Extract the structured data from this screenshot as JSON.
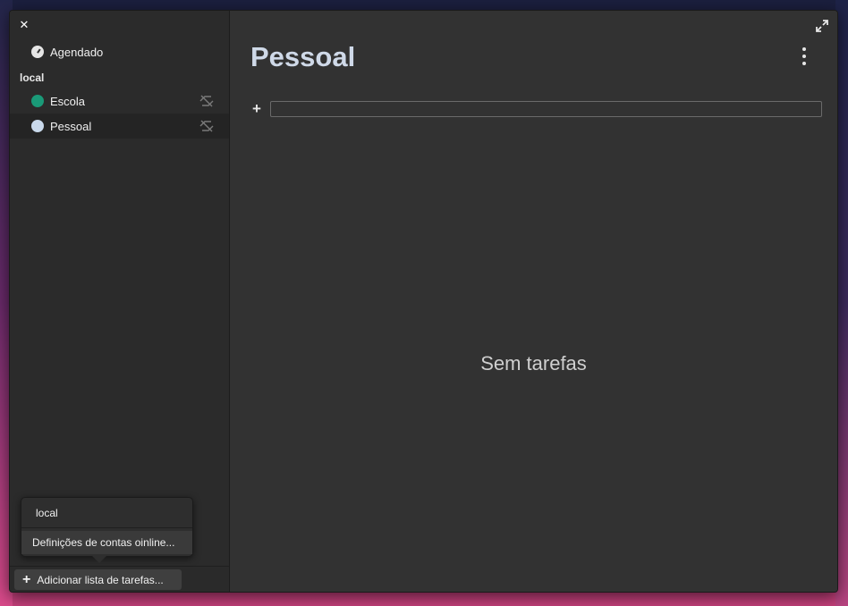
{
  "sidebar": {
    "scheduled": {
      "label": "Agendado",
      "icon": "clock-icon"
    },
    "section_label": "local",
    "lists": [
      {
        "label": "Escola",
        "color": "#1a9a78",
        "sync_icon": "sync-disabled-icon"
      },
      {
        "label": "Pessoal",
        "color": "#c9d9ec",
        "sync_icon": "sync-disabled-icon",
        "selected": true
      }
    ],
    "add_list_label": "Adicionar lista de tarefas..."
  },
  "popover": {
    "items": [
      {
        "label": "local"
      },
      {
        "label": "Definições de contas oinline..."
      }
    ]
  },
  "main": {
    "title": "Pessoal",
    "new_task_value": "",
    "empty_text": "Sem tarefas"
  },
  "colors": {
    "title": "#cfd9e8",
    "sidebar_bg": "#2b2b2b",
    "main_bg": "#323232"
  }
}
